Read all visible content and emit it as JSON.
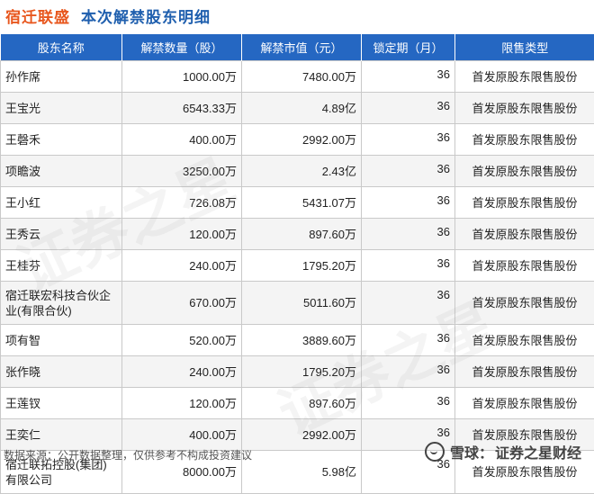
{
  "header": {
    "company": "宿迁联盛",
    "subtitle": "本次解禁股东明细"
  },
  "table": {
    "columns": [
      "股东名称",
      "解禁数量（股）",
      "解禁市值（元）",
      "锁定期（月）",
      "限售类型"
    ],
    "rows": [
      {
        "name": "孙作席",
        "shares": "1000.00万",
        "value": "7480.00万",
        "lock": "36",
        "type": "首发原股东限售股份"
      },
      {
        "name": "王宝光",
        "shares": "6543.33万",
        "value": "4.89亿",
        "lock": "36",
        "type": "首发原股东限售股份"
      },
      {
        "name": "王磬禾",
        "shares": "400.00万",
        "value": "2992.00万",
        "lock": "36",
        "type": "首发原股东限售股份"
      },
      {
        "name": "项瞻波",
        "shares": "3250.00万",
        "value": "2.43亿",
        "lock": "36",
        "type": "首发原股东限售股份"
      },
      {
        "name": "王小红",
        "shares": "726.08万",
        "value": "5431.07万",
        "lock": "36",
        "type": "首发原股东限售股份"
      },
      {
        "name": "王秀云",
        "shares": "120.00万",
        "value": "897.60万",
        "lock": "36",
        "type": "首发原股东限售股份"
      },
      {
        "name": "王桂芬",
        "shares": "240.00万",
        "value": "1795.20万",
        "lock": "36",
        "type": "首发原股东限售股份"
      },
      {
        "name": "宿迁联宏科技合伙企业(有限合伙)",
        "shares": "670.00万",
        "value": "5011.60万",
        "lock": "36",
        "type": "首发原股东限售股份"
      },
      {
        "name": "项有智",
        "shares": "520.00万",
        "value": "3889.60万",
        "lock": "36",
        "type": "首发原股东限售股份"
      },
      {
        "name": "张作晓",
        "shares": "240.00万",
        "value": "1795.20万",
        "lock": "36",
        "type": "首发原股东限售股份"
      },
      {
        "name": "王莲钗",
        "shares": "120.00万",
        "value": "897.60万",
        "lock": "36",
        "type": "首发原股东限售股份"
      },
      {
        "name": "王奕仁",
        "shares": "400.00万",
        "value": "2992.00万",
        "lock": "36",
        "type": "首发原股东限售股份"
      },
      {
        "name": "宿迁联拓控股(集团)有限公司",
        "shares": "8000.00万",
        "value": "5.98亿",
        "lock": "36",
        "type": "首发原股东限售股份"
      }
    ]
  },
  "watermark": "证券之星",
  "footer": {
    "source": "数据来源：公开数据整理，仅供参考不构成投资建议"
  },
  "brand": {
    "part1": "雪球：",
    "part2": "证券之星财经"
  }
}
